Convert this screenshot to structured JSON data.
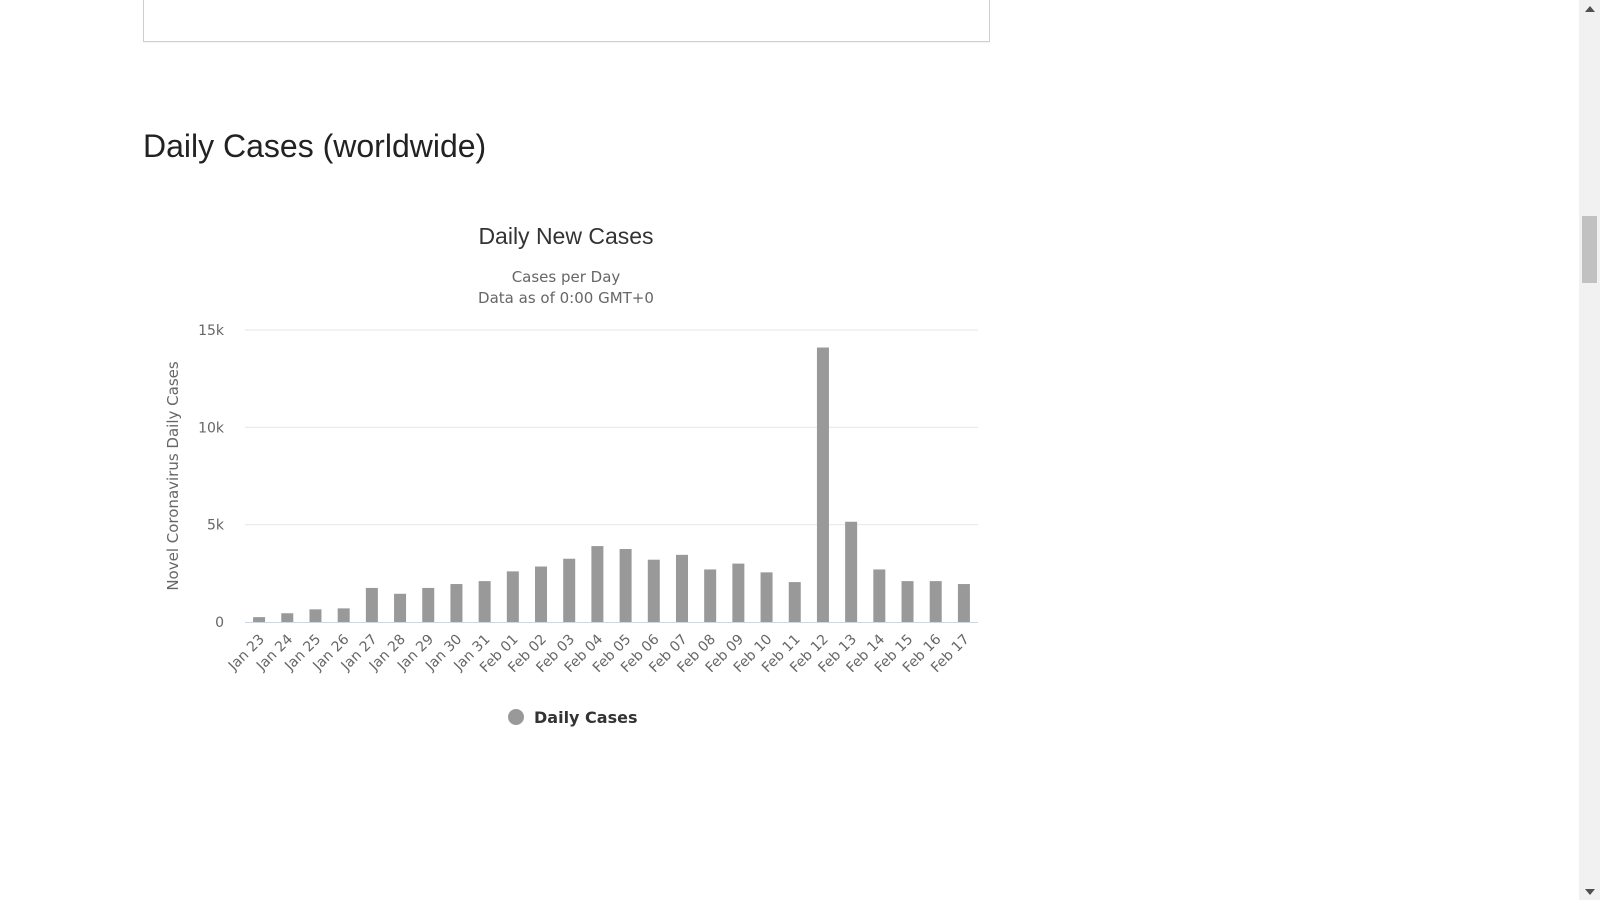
{
  "section": {
    "heading": "Daily Cases (worldwide)"
  },
  "colors": {
    "bar": "#999999",
    "grid": "#e6e6e6",
    "axis_line": "#ccd6eb",
    "text": "#333333",
    "subtext": "#666666"
  },
  "chart_data": {
    "type": "bar",
    "title": "Daily New Cases",
    "subtitle_lines": [
      "Cases per Day",
      "Data as of 0:00 GMT+0"
    ],
    "ylabel": "Novel Coronavirus Daily Cases",
    "xlabel": "",
    "ylim": [
      0,
      15000
    ],
    "yticks": [
      0,
      5000,
      10000,
      15000
    ],
    "ytick_labels": [
      "0",
      "5k",
      "10k",
      "15k"
    ],
    "grid": true,
    "legend_position": "bottom-center",
    "categories": [
      "Jan 23",
      "Jan 24",
      "Jan 25",
      "Jan 26",
      "Jan 27",
      "Jan 28",
      "Jan 29",
      "Jan 30",
      "Jan 31",
      "Feb 01",
      "Feb 02",
      "Feb 03",
      "Feb 04",
      "Feb 05",
      "Feb 06",
      "Feb 07",
      "Feb 08",
      "Feb 09",
      "Feb 10",
      "Feb 11",
      "Feb 12",
      "Feb 13",
      "Feb 14",
      "Feb 15",
      "Feb 16",
      "Feb 17"
    ],
    "series": [
      {
        "name": "Daily Cases",
        "values": [
          250,
          450,
          650,
          700,
          1750,
          1450,
          1750,
          1950,
          2100,
          2600,
          2850,
          3250,
          3900,
          3750,
          3200,
          3450,
          2700,
          3000,
          2550,
          2050,
          14100,
          5150,
          2700,
          2100,
          2100,
          1950
        ]
      }
    ]
  },
  "scrollbar": {
    "up_icon": "triangle-up-icon",
    "down_icon": "triangle-down-icon"
  }
}
